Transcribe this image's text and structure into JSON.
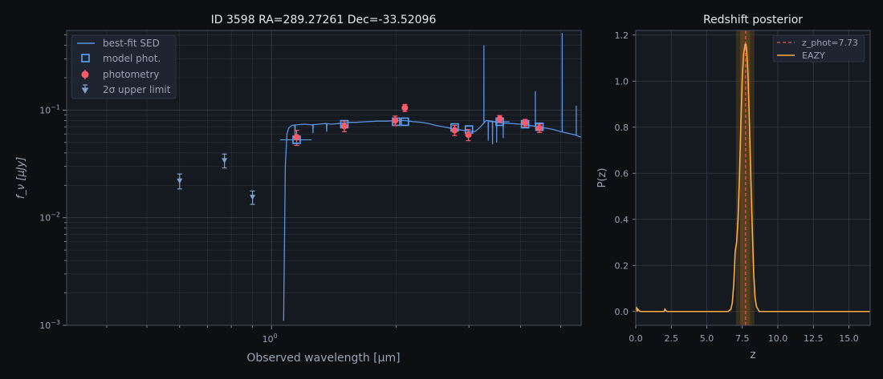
{
  "colors": {
    "background": "#0e0f13",
    "panel": "#151920",
    "grid": "#3a414d",
    "frame": "#4a5060",
    "text": "#e6e8ec",
    "muted": "#9aa3b2",
    "sed": "#5a93e0",
    "model_phot": "#5aa5ff",
    "photometry": "#ff5a68",
    "upper_limit": "#7fa3c8",
    "eazy": "#ffae3f",
    "zphot": "#e05a5a",
    "band": "#7a5520"
  },
  "chart_data": [
    {
      "type": "scatter",
      "title": "ID 3598  RA=289.27261  Dec=-33.52096",
      "xlabel": "Observed wavelength [μm]",
      "ylabel": "f_ν [μJy]",
      "xscale": "log",
      "yscale": "log",
      "xlim": [
        0.32,
        5.6
      ],
      "ylim": [
        0.001,
        0.55
      ],
      "grid": true,
      "xticks": [
        {
          "value": 1.0,
          "label": "10"
        }
      ],
      "x_tick_sup": "0",
      "yticks": [
        {
          "value": 0.1,
          "label": "10",
          "sup": "−1"
        },
        {
          "value": 0.01,
          "label": "10",
          "sup": "−2"
        },
        {
          "value": 0.001,
          "label": "10",
          "sup": "−3"
        }
      ],
      "legend": {
        "position": "top-left",
        "entries": [
          "best-fit SED",
          "model phot.",
          "photometry",
          "2σ upper limit"
        ]
      },
      "series": [
        {
          "name": "best-fit SED",
          "style": "line",
          "x": [
            1.07,
            1.08,
            1.09,
            1.1,
            1.12,
            1.15,
            1.2,
            1.25,
            1.3,
            1.35,
            1.4,
            1.45,
            1.5,
            1.55,
            1.6,
            1.7,
            1.8,
            1.9,
            2.0,
            2.1,
            2.2,
            2.3,
            2.4,
            2.5,
            2.6,
            2.7,
            2.8,
            2.9,
            3.0,
            3.1,
            3.2,
            3.3,
            3.4,
            3.5,
            3.6,
            3.8,
            4.0,
            4.2,
            4.4,
            4.6,
            4.8,
            5.0,
            5.2,
            5.4,
            5.6
          ],
          "y": [
            0.0011,
            0.03,
            0.06,
            0.068,
            0.072,
            0.073,
            0.074,
            0.073,
            0.074,
            0.075,
            0.074,
            0.075,
            0.076,
            0.077,
            0.077,
            0.078,
            0.079,
            0.079,
            0.08,
            0.08,
            0.078,
            0.077,
            0.075,
            0.072,
            0.07,
            0.068,
            0.066,
            0.065,
            0.064,
            0.063,
            0.07,
            0.08,
            0.079,
            0.077,
            0.076,
            0.075,
            0.074,
            0.072,
            0.07,
            0.068,
            0.066,
            0.063,
            0.061,
            0.059,
            0.056
          ],
          "spikes": [
            {
              "x": 3.26,
              "y": 0.4
            },
            {
              "x": 4.34,
              "y": 0.15
            },
            {
              "x": 5.04,
              "y": 0.52
            },
            {
              "x": 5.45,
              "y": 0.11
            }
          ],
          "dips": [
            {
              "x": 1.14,
              "y": 0.058
            },
            {
              "x": 1.26,
              "y": 0.061
            },
            {
              "x": 1.36,
              "y": 0.063
            },
            {
              "x": 3.34,
              "y": 0.052
            },
            {
              "x": 3.42,
              "y": 0.048
            },
            {
              "x": 3.5,
              "y": 0.05
            },
            {
              "x": 3.63,
              "y": 0.055
            }
          ]
        },
        {
          "name": "model phot.",
          "style": "square",
          "x": [
            1.15,
            1.5,
            2.0,
            2.1,
            2.77,
            3.0,
            3.56,
            4.1,
            4.44
          ],
          "y": [
            0.053,
            0.074,
            0.078,
            0.078,
            0.069,
            0.066,
            0.078,
            0.074,
            0.07
          ],
          "xerr": [
            0.1,
            0,
            0,
            0,
            0,
            0,
            0.2,
            0,
            0
          ]
        },
        {
          "name": "photometry",
          "style": "errorbar",
          "x": [
            1.15,
            1.5,
            1.99,
            2.1,
            2.77,
            2.99,
            3.56,
            4.1,
            4.44
          ],
          "y": [
            0.056,
            0.071,
            0.08,
            0.105,
            0.065,
            0.059,
            0.083,
            0.076,
            0.068
          ],
          "yerr": [
            0.009,
            0.008,
            0.008,
            0.008,
            0.007,
            0.007,
            0.006,
            0.006,
            0.006
          ]
        },
        {
          "name": "2σ upper limit",
          "style": "upper_limit",
          "x": [
            0.6,
            0.77,
            0.9
          ],
          "y": [
            0.022,
            0.034,
            0.0155
          ],
          "yerr": [
            0.0035,
            0.005,
            0.0022
          ]
        }
      ]
    },
    {
      "type": "line",
      "title": "Redshift posterior",
      "xlabel": "z",
      "ylabel": "P(z)",
      "xlim": [
        0,
        16.5
      ],
      "ylim": [
        -0.06,
        1.22
      ],
      "grid": true,
      "xticks": [
        0.0,
        2.5,
        5.0,
        7.5,
        10.0,
        12.5,
        15.0
      ],
      "yticks": [
        0.0,
        0.2,
        0.4,
        0.6,
        0.8,
        1.0,
        1.2
      ],
      "legend": {
        "position": "top-right",
        "entries": [
          "z_phot=7.73",
          "EAZY"
        ]
      },
      "z_phot": 7.73,
      "band": [
        7.05,
        8.35
      ],
      "band_inner": [
        7.35,
        8.05
      ],
      "series": [
        {
          "name": "EAZY",
          "x": [
            0.0,
            0.05,
            0.1,
            0.15,
            0.3,
            1.0,
            2.0,
            2.05,
            2.1,
            2.2,
            2.3,
            2.5,
            4.0,
            6.5,
            6.7,
            6.8,
            6.9,
            7.0,
            7.1,
            7.2,
            7.3,
            7.4,
            7.5,
            7.6,
            7.7,
            7.75,
            7.8,
            7.9,
            8.0,
            8.1,
            8.2,
            8.3,
            8.4,
            8.5,
            8.7,
            9.0,
            12.0,
            16.5
          ],
          "y": [
            0.01,
            0.02,
            0.0,
            0.01,
            0.0,
            0.0,
            0.0,
            0.01,
            0.005,
            0.0,
            0.0,
            0.0,
            0.0,
            0.0,
            0.01,
            0.04,
            0.12,
            0.26,
            0.3,
            0.4,
            0.58,
            0.82,
            1.02,
            1.12,
            1.16,
            1.16,
            1.14,
            1.03,
            0.82,
            0.58,
            0.36,
            0.17,
            0.06,
            0.02,
            0.0,
            0.0,
            0.0,
            0.0
          ]
        },
        {
          "name": "z_phot=7.73",
          "style": "dashed-vline"
        }
      ]
    }
  ]
}
